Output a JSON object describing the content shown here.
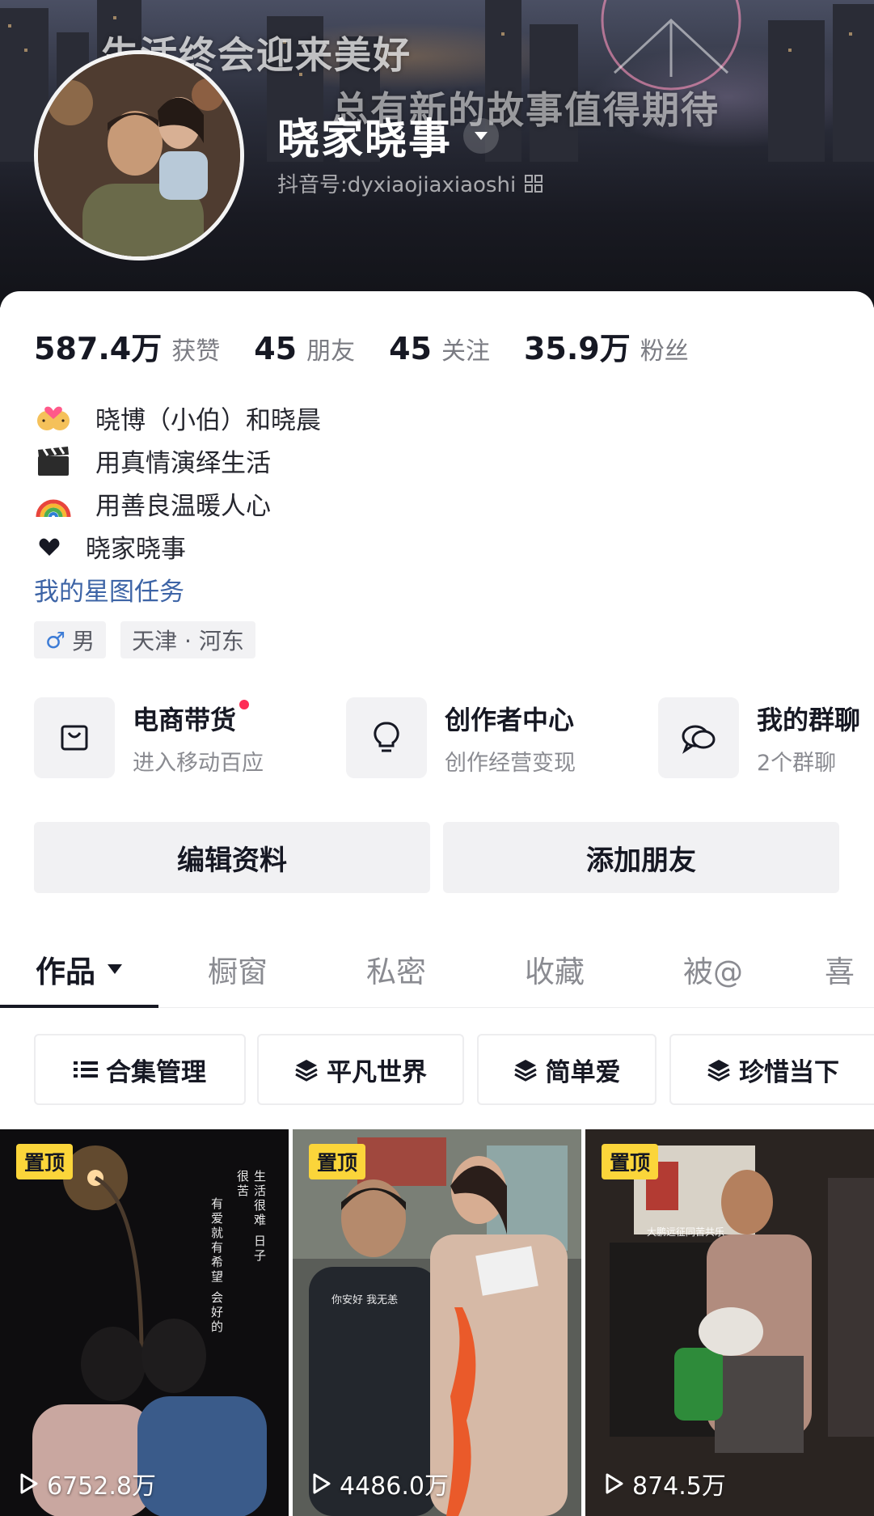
{
  "banner": {
    "slogan_1": "生活终会迎来美好",
    "slogan_2": "总有新的故事值得期待"
  },
  "profile": {
    "nickname": "晓家晓事",
    "uid": "抖音号:dyxiaojiaxiaoshi"
  },
  "stats": [
    {
      "num": "587.4万",
      "label": "获赞"
    },
    {
      "num": "45",
      "label": "朋友"
    },
    {
      "num": "45",
      "label": "关注"
    },
    {
      "num": "35.9万",
      "label": "粉丝"
    }
  ],
  "bio": {
    "lines": [
      {
        "icon": "couple-emoji",
        "text": "晓博（小伯）和晓晨"
      },
      {
        "icon": "clapper-emoji",
        "text": "用真情演绎生活"
      },
      {
        "icon": "rainbow-emoji",
        "text": "用善良温暖人心"
      },
      {
        "icon": "heart-icon",
        "text": "晓家晓事"
      }
    ],
    "link": "我的星图任务"
  },
  "tags": {
    "gender_symbol": "♂",
    "gender": "男",
    "location": "天津 · 河东"
  },
  "services": [
    {
      "icon": "shopping-bag-icon",
      "title": "电商带货",
      "subtitle": "进入移动百应",
      "has_dot": true
    },
    {
      "icon": "lightbulb-icon",
      "title": "创作者中心",
      "subtitle": "创作经营变现",
      "has_dot": false
    },
    {
      "icon": "chat-bubbles-icon",
      "title": "我的群聊",
      "subtitle": "2个群聊",
      "has_dot": false
    }
  ],
  "actions": {
    "edit_profile": "编辑资料",
    "add_friend": "添加朋友"
  },
  "tabs": [
    {
      "label": "作品",
      "active": true
    },
    {
      "label": "橱窗",
      "active": false
    },
    {
      "label": "私密",
      "active": false
    },
    {
      "label": "收藏",
      "active": false
    },
    {
      "label": "被@",
      "active": false
    },
    {
      "label": "喜",
      "active": false
    }
  ],
  "collections": [
    {
      "icon": "list-icon",
      "label": "合集管理"
    },
    {
      "icon": "stack-icon",
      "label": "平凡世界"
    },
    {
      "icon": "stack-icon",
      "label": "简单爱"
    },
    {
      "icon": "stack-icon",
      "label": "珍惜当下"
    }
  ],
  "videos": [
    {
      "pin": "置顶",
      "plays": "6752.8万"
    },
    {
      "pin": "置顶",
      "plays": "4486.0万"
    },
    {
      "pin": "置顶",
      "plays": "874.5万"
    }
  ],
  "colors": {
    "accent_link": "#3d64a6",
    "notify_dot": "#fe2c55",
    "pin_badge": "#fbd53a"
  }
}
